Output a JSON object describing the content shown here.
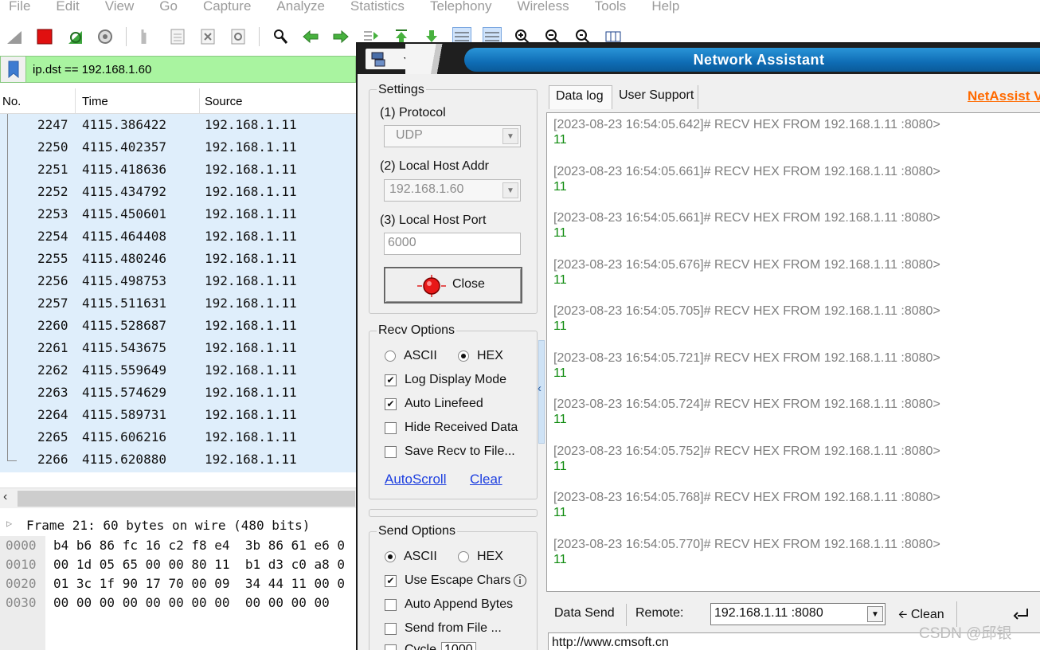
{
  "wireshark": {
    "menu": [
      "File",
      "Edit",
      "View",
      "Go",
      "Capture",
      "Analyze",
      "Statistics",
      "Telephony",
      "Wireless",
      "Tools",
      "Help"
    ],
    "filter": "ip.dst == 192.168.1.60",
    "columns": {
      "no": "No.",
      "time": "Time",
      "source": "Source"
    },
    "packets": [
      {
        "no": "2247",
        "time": "4115.386422",
        "source": "192.168.1.11"
      },
      {
        "no": "2250",
        "time": "4115.402357",
        "source": "192.168.1.11"
      },
      {
        "no": "2251",
        "time": "4115.418636",
        "source": "192.168.1.11"
      },
      {
        "no": "2252",
        "time": "4115.434792",
        "source": "192.168.1.11"
      },
      {
        "no": "2253",
        "time": "4115.450601",
        "source": "192.168.1.11"
      },
      {
        "no": "2254",
        "time": "4115.464408",
        "source": "192.168.1.11"
      },
      {
        "no": "2255",
        "time": "4115.480246",
        "source": "192.168.1.11"
      },
      {
        "no": "2256",
        "time": "4115.498753",
        "source": "192.168.1.11"
      },
      {
        "no": "2257",
        "time": "4115.511631",
        "source": "192.168.1.11"
      },
      {
        "no": "2260",
        "time": "4115.528687",
        "source": "192.168.1.11"
      },
      {
        "no": "2261",
        "time": "4115.543675",
        "source": "192.168.1.11"
      },
      {
        "no": "2262",
        "time": "4115.559649",
        "source": "192.168.1.11"
      },
      {
        "no": "2263",
        "time": "4115.574629",
        "source": "192.168.1.11"
      },
      {
        "no": "2264",
        "time": "4115.589731",
        "source": "192.168.1.11"
      },
      {
        "no": "2265",
        "time": "4115.606216",
        "source": "192.168.1.11"
      },
      {
        "no": "2266",
        "time": "4115.620880",
        "source": "192.168.1.11"
      }
    ],
    "detail": "Frame 21: 60 bytes on wire (480 bits)",
    "bytes": [
      {
        "offset": "0000",
        "hex": "b4 b6 86 fc 16 c2 f8 e4  3b 86 61 e6 0"
      },
      {
        "offset": "0010",
        "hex": "00 1d 05 65 00 00 80 11  b1 d3 c0 a8 0"
      },
      {
        "offset": "0020",
        "hex": "01 3c 1f 90 17 70 00 09  34 44 11 00 0"
      },
      {
        "offset": "0030",
        "hex": "00 00 00 00 00 00 00 00  00 00 00 00"
      }
    ]
  },
  "netassist": {
    "title": "Network Assistant",
    "settings": {
      "group_label": "Settings",
      "protocol_label": "(1) Protocol",
      "protocol_value": "UDP",
      "host_addr_label": "(2) Local Host Addr",
      "host_addr_value": "192.168.1.60",
      "host_port_label": "(3) Local Host Port",
      "host_port_value": "6000",
      "close_button": "Close"
    },
    "recv_options": {
      "group_label": "Recv Options",
      "ascii": "ASCII",
      "hex": "HEX",
      "selected": "HEX",
      "log_display": "Log Display Mode",
      "auto_linefeed": "Auto Linefeed",
      "hide_received": "Hide Received Data",
      "save_recv": "Save Recv to File...",
      "autoscroll": "AutoScroll",
      "clear": "Clear"
    },
    "send_options": {
      "group_label": "Send Options",
      "ascii": "ASCII",
      "hex": "HEX",
      "selected": "ASCII",
      "escape_chars": "Use Escape Chars",
      "auto_append": "Auto Append Bytes",
      "send_from_file": "Send from File ...",
      "cycle_label": "Cycle",
      "cycle_value": "1000"
    },
    "tabs": [
      "Data log",
      "User Support"
    ],
    "brand": "NetAssist V",
    "log": [
      {
        "header": "[2023-08-23 16:54:05.642]# RECV HEX FROM 192.168.1.11 :8080>",
        "data": "11"
      },
      {
        "header": "[2023-08-23 16:54:05.661]# RECV HEX FROM 192.168.1.11 :8080>",
        "data": "11"
      },
      {
        "header": "[2023-08-23 16:54:05.661]# RECV HEX FROM 192.168.1.11 :8080>",
        "data": "11"
      },
      {
        "header": "[2023-08-23 16:54:05.676]# RECV HEX FROM 192.168.1.11 :8080>",
        "data": "11"
      },
      {
        "header": "[2023-08-23 16:54:05.705]# RECV HEX FROM 192.168.1.11 :8080>",
        "data": "11"
      },
      {
        "header": "[2023-08-23 16:54:05.721]# RECV HEX FROM 192.168.1.11 :8080>",
        "data": "11"
      },
      {
        "header": "[2023-08-23 16:54:05.724]# RECV HEX FROM 192.168.1.11 :8080>",
        "data": "11"
      },
      {
        "header": "[2023-08-23 16:54:05.752]# RECV HEX FROM 192.168.1.11 :8080>",
        "data": "11"
      },
      {
        "header": "[2023-08-23 16:54:05.768]# RECV HEX FROM 192.168.1.11 :8080>",
        "data": "11"
      },
      {
        "header": "[2023-08-23 16:54:05.770]# RECV HEX FROM 192.168.1.11 :8080>",
        "data": "11"
      }
    ],
    "send": {
      "data_send": "Data Send",
      "remote_label": "Remote:",
      "remote_value": "192.168.1.11 :8080",
      "clean": "Clean",
      "send_text": "http://www.cmsoft.cn"
    }
  },
  "watermark": "CSDN @邱银"
}
